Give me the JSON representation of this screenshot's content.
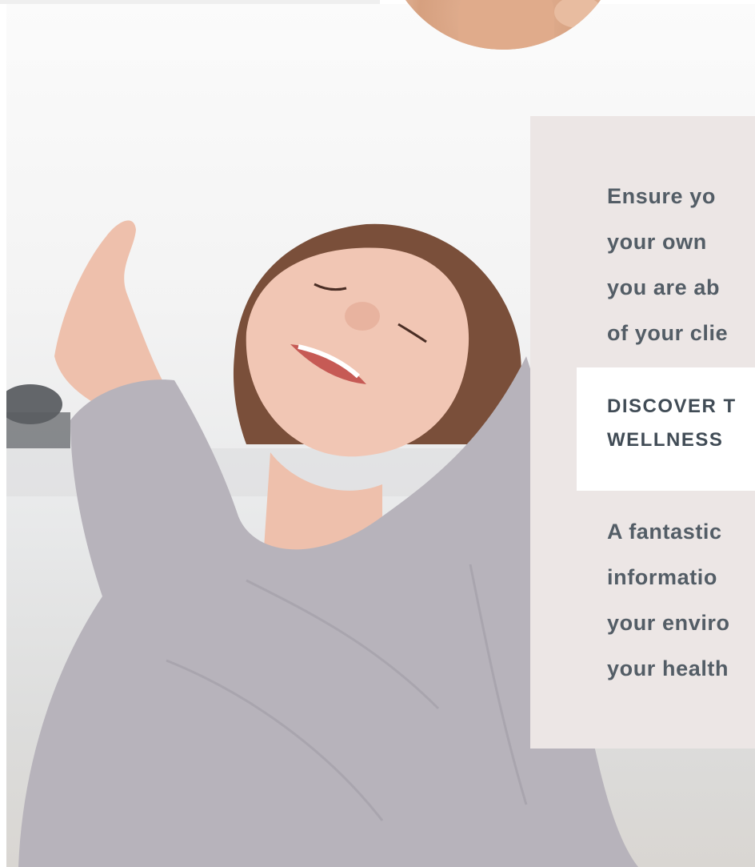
{
  "info_card": {
    "intro_text": "Ensure yo\nyour own\nyou are ab\nof your clie",
    "cta_label": "DISCOVER T\nWELLNESS",
    "body_text": "A fantastic\ninformatio\nyour enviro\nyour health"
  }
}
